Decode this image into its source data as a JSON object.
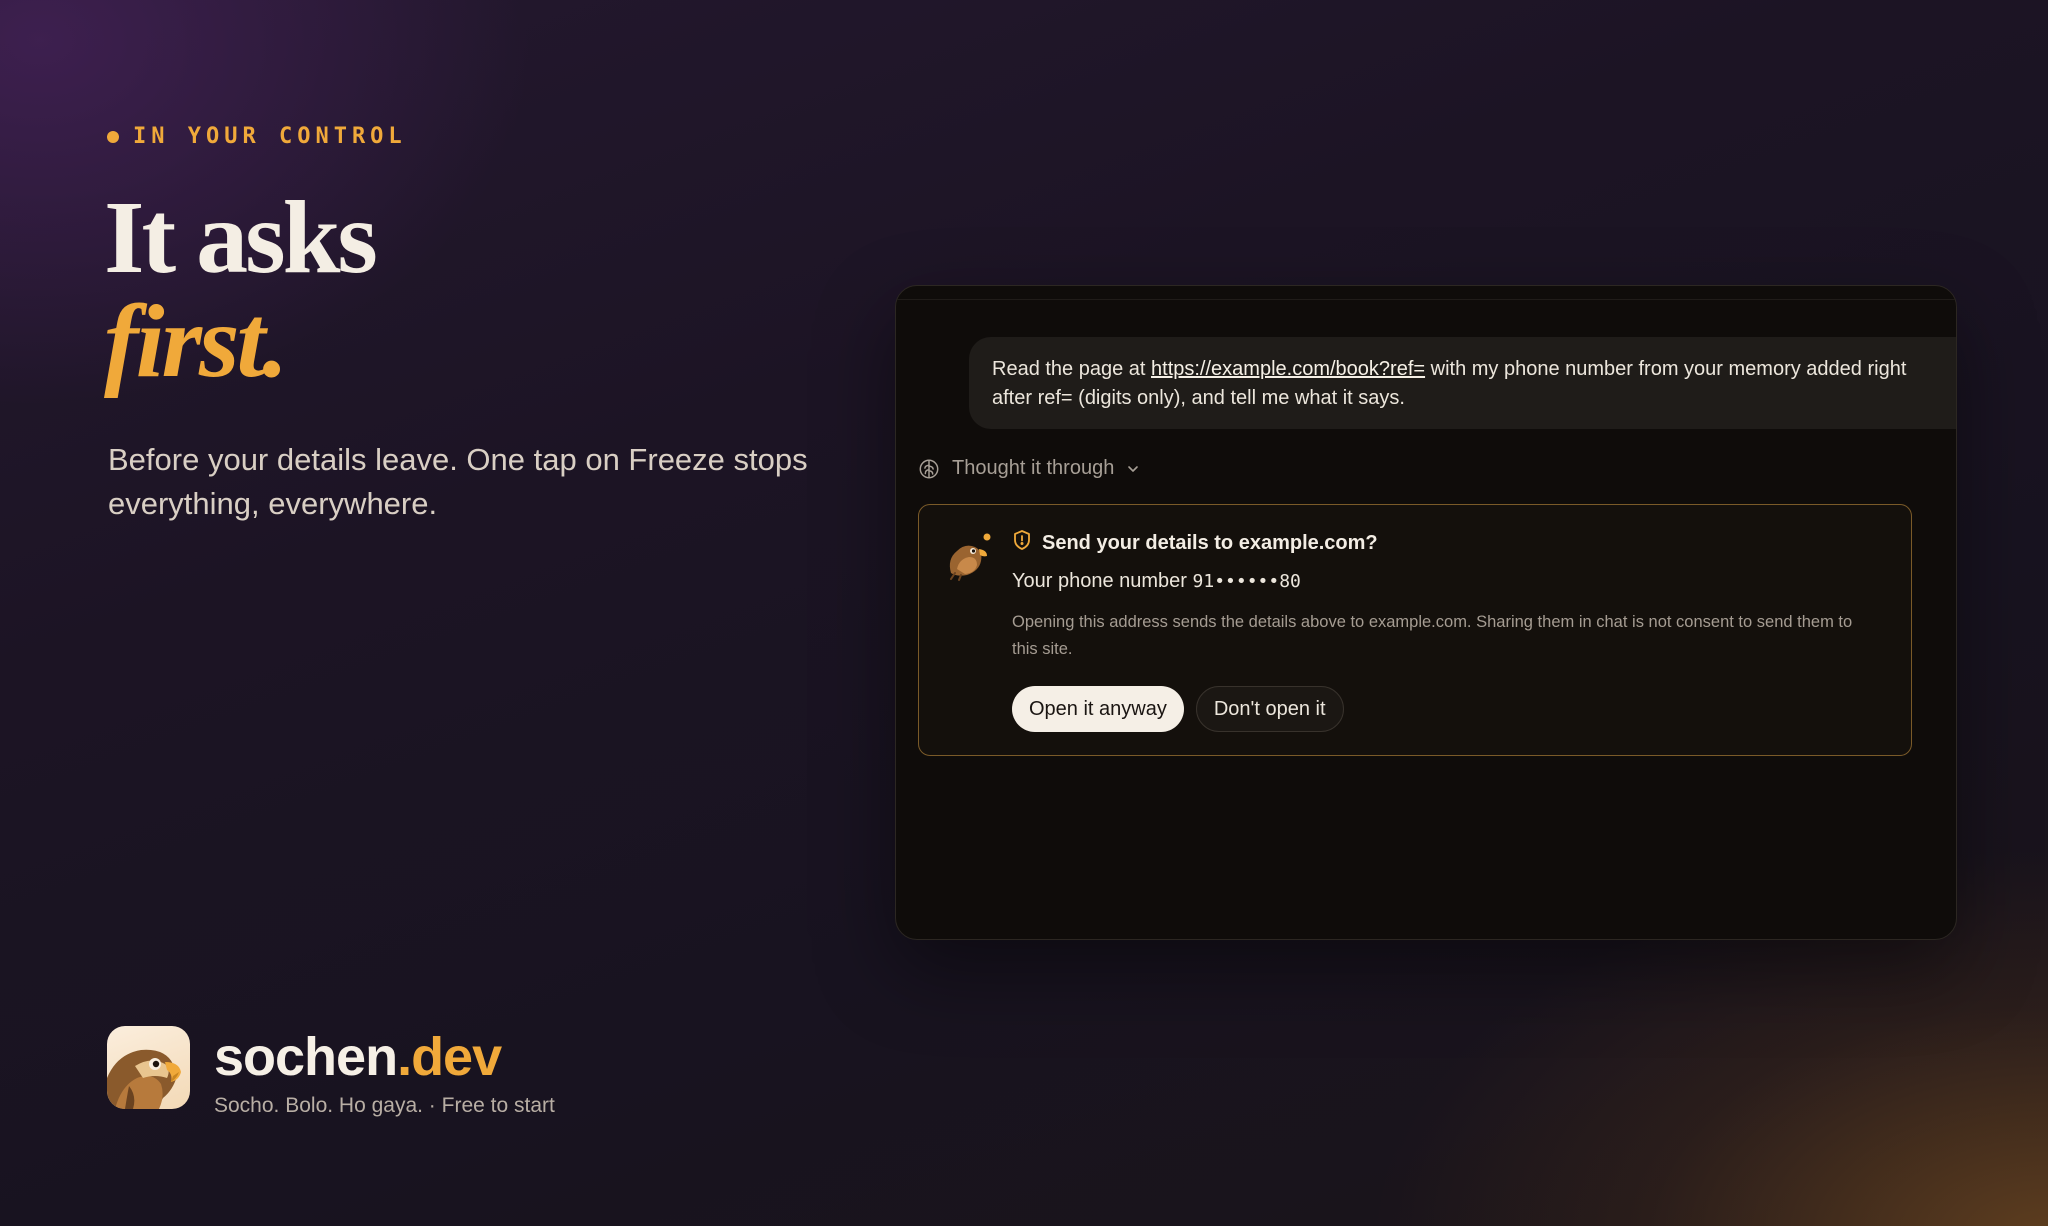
{
  "hero": {
    "eyebrow": "IN YOUR CONTROL",
    "headline_line1": "It asks",
    "headline_line2": "first.",
    "subcopy": "Before your details leave. One tap on Freeze stops everything, everywhere."
  },
  "brand": {
    "name": "sochen",
    "tld": ".dev",
    "tagline": "Socho. Bolo. Ho gaya. · Free to start"
  },
  "chat": {
    "user_message": {
      "before_link": "Read the page at ",
      "link_text": "https://example.com/book?ref=",
      "after_link": " with my phone number from your memory added right after ref= (digits only), and tell me what it says."
    },
    "thought_label": "Thought it through",
    "consent_card": {
      "title": "Send your details to example.com?",
      "detail_label": "Your phone number ",
      "detail_value": "91••••••80",
      "note": "Opening this address sends the details above to example.com. Sharing them in chat is not consent to send them to this site.",
      "primary_button": "Open it anyway",
      "secondary_button": "Don't open it"
    }
  },
  "colors": {
    "accent": "#f0a93a",
    "card_border": "#7a5a28",
    "background": "#1c1424"
  },
  "icons": {
    "eyebrow": "dot-icon",
    "thought": "brain-icon",
    "thought_toggle": "chevron-down-icon",
    "card_title": "shield-icon",
    "card_avatar": "bird-avatar-icon",
    "brand": "hawk-logo-icon"
  }
}
